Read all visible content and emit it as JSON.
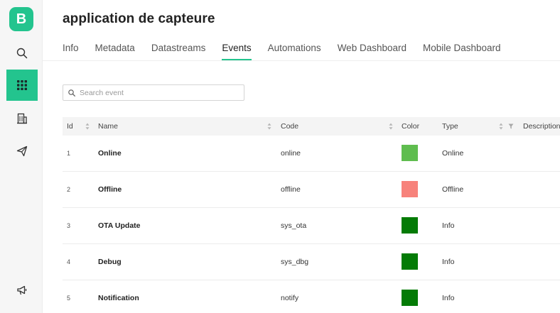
{
  "sidebar": {
    "logo_letter": "B",
    "items": [
      {
        "icon": "search-icon"
      },
      {
        "icon": "grid-icon",
        "active": true
      },
      {
        "icon": "building-icon"
      },
      {
        "icon": "paper-plane-icon"
      },
      {
        "icon": "megaphone-icon"
      }
    ],
    "accent": "#23c48e"
  },
  "header": {
    "title": "application de capteure"
  },
  "tabs": [
    {
      "label": "Info",
      "active": false
    },
    {
      "label": "Metadata",
      "active": false
    },
    {
      "label": "Datastreams",
      "active": false
    },
    {
      "label": "Events",
      "active": true
    },
    {
      "label": "Automations",
      "active": false
    },
    {
      "label": "Web Dashboard",
      "active": false
    },
    {
      "label": "Mobile Dashboard",
      "active": false
    }
  ],
  "search": {
    "placeholder": "Search event",
    "value": ""
  },
  "table": {
    "columns": {
      "id": "Id",
      "name": "Name",
      "code": "Code",
      "color": "Color",
      "type": "Type",
      "description": "Description"
    },
    "rows": [
      {
        "id": "1",
        "name": "Online",
        "code": "online",
        "color": "#5fbd4f",
        "type": "Online"
      },
      {
        "id": "2",
        "name": "Offline",
        "code": "offline",
        "color": "#f7827b",
        "type": "Offline"
      },
      {
        "id": "3",
        "name": "OTA Update",
        "code": "sys_ota",
        "color": "#047b06",
        "type": "Info"
      },
      {
        "id": "4",
        "name": "Debug",
        "code": "sys_dbg",
        "color": "#047b06",
        "type": "Info"
      },
      {
        "id": "5",
        "name": "Notification",
        "code": "notify",
        "color": "#047b06",
        "type": "Info"
      }
    ]
  }
}
